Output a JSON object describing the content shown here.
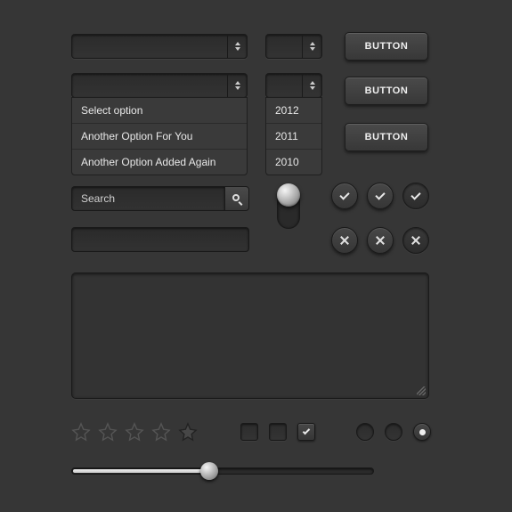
{
  "buttons": {
    "primary_label": "BUTTON"
  },
  "selects": {
    "main": {
      "value": "",
      "options": [
        "Select option",
        "Another Option For You",
        "Another Option Added Again"
      ]
    },
    "year": {
      "value": "",
      "options": [
        "2012",
        "2011",
        "2010"
      ]
    }
  },
  "search": {
    "placeholder": "Search"
  },
  "textarea": {
    "value": ""
  },
  "rating": {
    "value": 0,
    "max": 5
  },
  "checkboxes": [
    false,
    false,
    true
  ],
  "radios": [
    false,
    false,
    true
  ],
  "slider": {
    "value": 45,
    "min": 0,
    "max": 100
  },
  "colors": {
    "bg": "#363636",
    "control": "#2e2e2e",
    "button_top": "#4a4a4a",
    "button_bottom": "#383838",
    "text": "#e8e8e8"
  }
}
